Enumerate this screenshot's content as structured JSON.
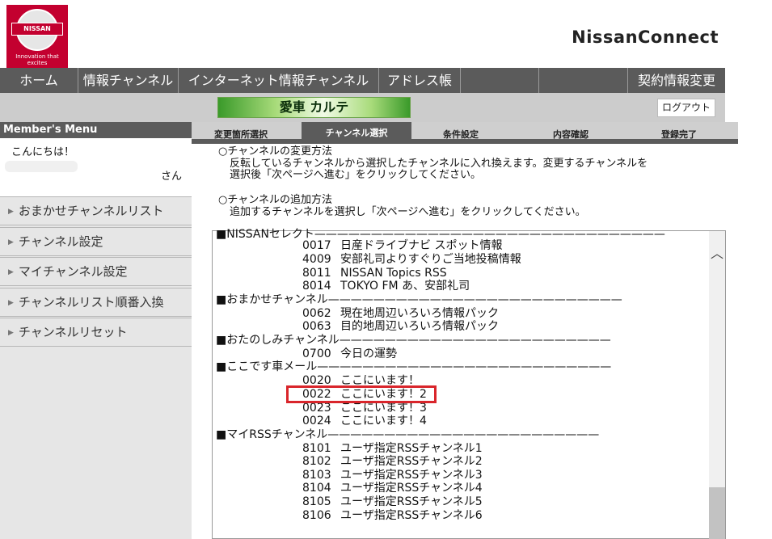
{
  "header": {
    "logo_text": "NISSAN",
    "logo_tagline": "Innovation that excites",
    "brand": "NissanConnect"
  },
  "topnav": {
    "items": [
      "ホーム",
      "情報チャンネル",
      "インターネット情報チャンネル",
      "アドレス帳",
      "",
      "",
      "契約情報変更"
    ]
  },
  "subbar": {
    "karte": "愛車 カルテ",
    "logout": "ログアウト"
  },
  "sidebar": {
    "menu_title": "Member's Menu",
    "greeting": "こんにちは！",
    "suffix": "さん",
    "items": [
      "おまかせチャンネルリスト",
      "チャンネル設定",
      "マイチャンネル設定",
      "チャンネルリスト順番入換",
      "チャンネルリセット"
    ]
  },
  "steps": [
    "変更箇所選択",
    "チャンネル選択",
    "条件設定",
    "内容確認",
    "登録完了"
  ],
  "instructions": {
    "change_title": "○チャンネルの変更方法",
    "change_line1": "反転しているチャンネルから選択したチャンネルに入れ換えます。変更するチャンネルを",
    "change_line2": "選択後「次ページへ進む」をクリックしてください。",
    "add_title": "○チャンネルの追加方法",
    "add_line1": "追加するチャンネルを選択し「次ページへ進む」をクリックしてください。"
  },
  "channel_list": {
    "categories": [
      "■NISSANセレクト———————————————————————————————",
      "■おまかせチャンネル——————————————————————————",
      "■おたのしみチャンネル————————————————————————",
      "■ここです車メール——————————————————————————",
      "■マイRSSチャンネル————————————————————————"
    ],
    "items": [
      {
        "code": "0017",
        "name": "日産ドライブナビ スポット情報"
      },
      {
        "code": "4009",
        "name": "安部礼司よりすぐりご当地投稿情報"
      },
      {
        "code": "8011",
        "name": "NISSAN Topics RSS"
      },
      {
        "code": "8014",
        "name": "TOKYO FM あ、安部礼司"
      },
      {
        "code": "0062",
        "name": "現在地周辺いろいろ情報パック"
      },
      {
        "code": "0063",
        "name": "目的地周辺いろいろ情報パック"
      },
      {
        "code": "0700",
        "name": "今日の運勢"
      },
      {
        "code": "0020",
        "name": "ここにいます！"
      },
      {
        "code": "0022",
        "name": "ここにいます！2"
      },
      {
        "code": "0023",
        "name": "ここにいます！3"
      },
      {
        "code": "0024",
        "name": "ここにいます！4"
      },
      {
        "code": "8101",
        "name": "ユーザ指定RSSチャンネル1"
      },
      {
        "code": "8102",
        "name": "ユーザ指定RSSチャンネル2"
      },
      {
        "code": "8103",
        "name": "ユーザ指定RSSチャンネル3"
      },
      {
        "code": "8104",
        "name": "ユーザ指定RSSチャンネル4"
      },
      {
        "code": "8105",
        "name": "ユーザ指定RSSチャンネル5"
      },
      {
        "code": "8106",
        "name": "ユーザ指定RSSチャンネル6"
      }
    ]
  },
  "colors": {
    "nav_bg": "#5b5b5b",
    "subbar_bg": "#cccccc",
    "sidebar_bg": "#e6e6e6",
    "brand_red": "#c3002f",
    "highlight": "#d9252b"
  }
}
